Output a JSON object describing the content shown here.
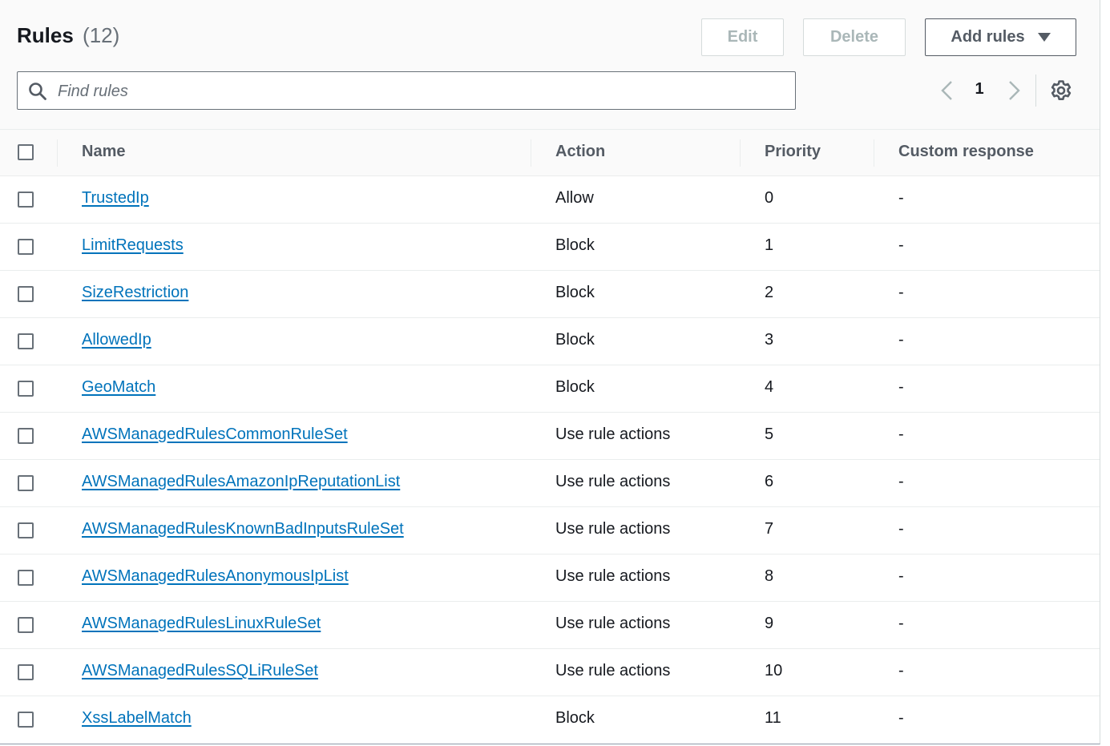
{
  "header": {
    "title": "Rules",
    "count": "(12)",
    "edit_label": "Edit",
    "delete_label": "Delete",
    "add_label": "Add rules"
  },
  "search": {
    "placeholder": "Find rules",
    "value": ""
  },
  "pagination": {
    "current_page": "1"
  },
  "table": {
    "columns": [
      "Name",
      "Action",
      "Priority",
      "Custom response"
    ],
    "rows": [
      {
        "name": "TrustedIp",
        "action": "Allow",
        "priority": "0",
        "custom_response": "-"
      },
      {
        "name": "LimitRequests",
        "action": "Block",
        "priority": "1",
        "custom_response": "-"
      },
      {
        "name": "SizeRestriction",
        "action": "Block",
        "priority": "2",
        "custom_response": "-"
      },
      {
        "name": "AllowedIp",
        "action": "Block",
        "priority": "3",
        "custom_response": "-"
      },
      {
        "name": "GeoMatch",
        "action": "Block",
        "priority": "4",
        "custom_response": "-"
      },
      {
        "name": "AWSManagedRulesCommonRuleSet",
        "action": "Use rule actions",
        "priority": "5",
        "custom_response": "-"
      },
      {
        "name": "AWSManagedRulesAmazonIpReputationList",
        "action": "Use rule actions",
        "priority": "6",
        "custom_response": "-"
      },
      {
        "name": "AWSManagedRulesKnownBadInputsRuleSet",
        "action": "Use rule actions",
        "priority": "7",
        "custom_response": "-"
      },
      {
        "name": "AWSManagedRulesAnonymousIpList",
        "action": "Use rule actions",
        "priority": "8",
        "custom_response": "-"
      },
      {
        "name": "AWSManagedRulesLinuxRuleSet",
        "action": "Use rule actions",
        "priority": "9",
        "custom_response": "-"
      },
      {
        "name": "AWSManagedRulesSQLiRuleSet",
        "action": "Use rule actions",
        "priority": "10",
        "custom_response": "-"
      },
      {
        "name": "XssLabelMatch",
        "action": "Block",
        "priority": "11",
        "custom_response": "-"
      }
    ]
  },
  "icons": {
    "search": "search-icon",
    "prev": "chevron-left-icon",
    "next": "chevron-right-icon",
    "settings": "gear-icon"
  },
  "colors": {
    "link": "#0073bb",
    "header_bg": "#fafafa",
    "text": "#16191f",
    "muted": "#687078",
    "disabled": "#aab7b8"
  }
}
